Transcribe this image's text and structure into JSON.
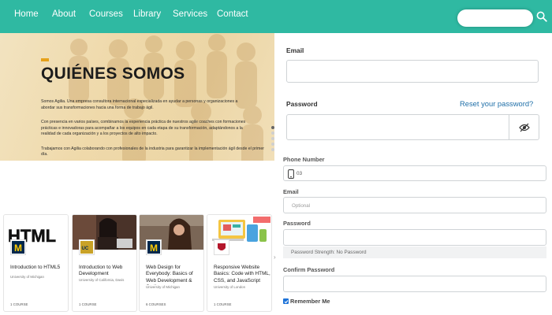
{
  "nav": {
    "items": [
      "Home",
      "About",
      "Courses",
      "Library",
      "Services",
      "Contact"
    ],
    "search_placeholder": "",
    "bg_color": "#2fb9a2"
  },
  "hero": {
    "title": "QUIÉNES SOMOS",
    "paragraph_1": "Somos Agilia. Una empresa consultora internacional especializada en ayudar a personas y organizaciones a abordar sus transformaciones hacia una forma de trabajo ágil.",
    "paragraph_2": "Con presencia en varios países, combinamos la experiencia práctica de nuestros agile coaches con formaciones prácticas e innovadoras para acompañar a los equipos en cada etapa de su transformación, adaptándonos a la realidad de cada organización y a los proyectos de alto impacto.",
    "paragraph_3": "Trabajamos con Agilia colaborando con profesionales de la industria para garantizar la implementación ágil desde el primer día.",
    "accent_color": "#e6a11a"
  },
  "courses": [
    {
      "title": "Introduction to HTML5",
      "university": "University of Michigan",
      "count": "1 COURSE",
      "image": "html-banner",
      "logo": "michigan-logo"
    },
    {
      "title": "Introduction to Web Development",
      "university": "University of California, Davis",
      "count": "1 COURSE",
      "image": "woman-laptop-photo",
      "logo": "uc-davis-logo"
    },
    {
      "title": "Web Design for Everybody: Basics of Web Development & Coding",
      "university": "University of Michigan",
      "count": "6 COURSES",
      "image": "woman-with-hair-photo",
      "logo": "michigan-logo"
    },
    {
      "title": "Responsive Website Basics: Code with HTML, CSS, and JavaScript",
      "university": "University of London",
      "count": "1 COURSE",
      "image": "responsive-devices-illustration",
      "logo": "london-logo"
    }
  ],
  "login_form": {
    "email_label": "Email",
    "password_label": "Password",
    "reset_link": "Reset your password?",
    "eye_icon": "eye-slash-icon"
  },
  "register_form": {
    "phone_label": "Phone Number",
    "phone_value": "03",
    "email_label": "Email",
    "email_placeholder": "Optional",
    "password_label": "Password",
    "strength_text": "Password Strength: No Password",
    "confirm_label": "Confirm Password",
    "remember_label": "Remember Me",
    "remember_checked": true
  }
}
